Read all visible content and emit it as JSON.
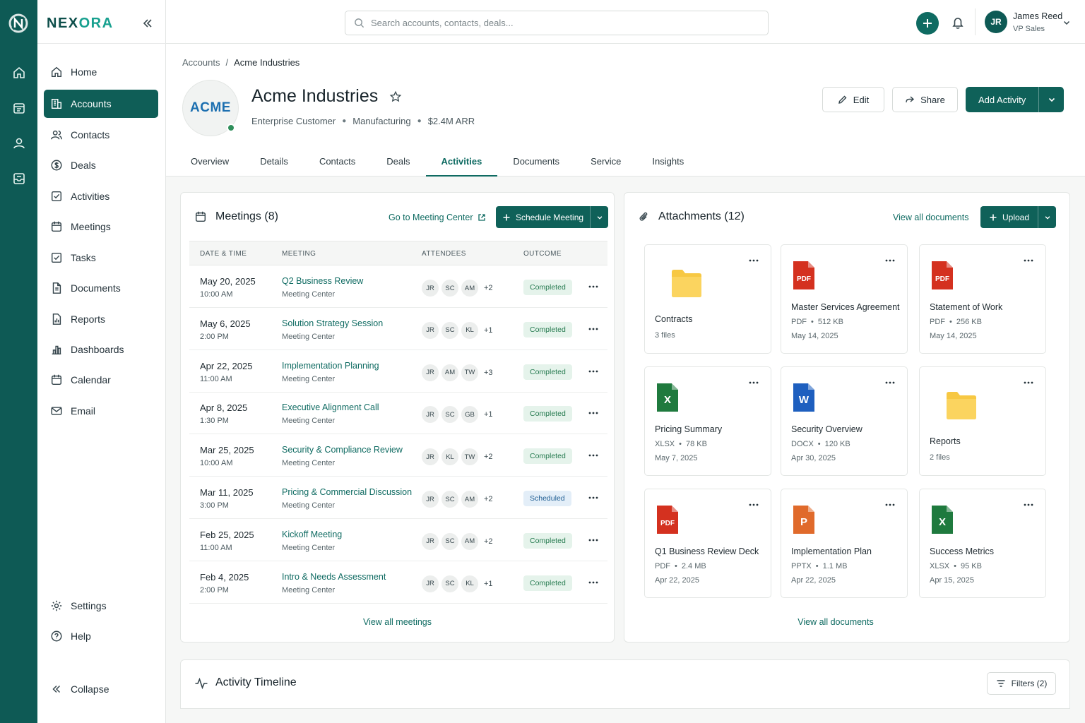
{
  "brand": {
    "name_part1": "NEX",
    "name_part2": "ORA"
  },
  "sidebar": {
    "items": [
      {
        "label": "Home",
        "icon": "home-icon"
      },
      {
        "label": "Accounts",
        "icon": "building-icon",
        "active": true
      },
      {
        "label": "Contacts",
        "icon": "people-icon"
      },
      {
        "label": "Deals",
        "icon": "dollar-icon"
      },
      {
        "label": "Activities",
        "icon": "check-square-icon"
      },
      {
        "label": "Meetings",
        "icon": "calendar-icon"
      },
      {
        "label": "Tasks",
        "icon": "checkbox-icon"
      },
      {
        "label": "Documents",
        "icon": "document-icon"
      },
      {
        "label": "Reports",
        "icon": "report-icon"
      },
      {
        "label": "Dashboards",
        "icon": "bar-chart-icon"
      },
      {
        "label": "Calendar",
        "icon": "calendar-icon"
      },
      {
        "label": "Email",
        "icon": "mail-icon"
      }
    ],
    "settings_label": "Settings",
    "help_label": "Help",
    "collapse_label": "Collapse"
  },
  "topbar": {
    "search_placeholder": "Search accounts, contacts, deals...",
    "user": {
      "initials": "JR",
      "name": "James Reed",
      "role": "VP Sales"
    }
  },
  "breadcrumb": {
    "parent": "Accounts",
    "separator": "/",
    "current": "Acme Industries"
  },
  "account": {
    "logo_text": "ACME",
    "name": "Acme Industries",
    "type": "Enterprise Customer",
    "industry": "Manufacturing",
    "arr": "$2.4M ARR",
    "status_color": "#2f8f5b"
  },
  "actions": {
    "edit": "Edit",
    "share": "Share",
    "add_activity": "Add Activity"
  },
  "tabs": [
    "Overview",
    "Details",
    "Contacts",
    "Deals",
    "Activities",
    "Documents",
    "Service",
    "Insights"
  ],
  "active_tab": "Activities",
  "meetings": {
    "title": "Meetings (8)",
    "go_link": "Go to Meeting Center",
    "schedule_label": "Schedule Meeting",
    "columns": [
      "DATE & TIME",
      "MEETING",
      "ATTENDEES",
      "OUTCOME"
    ],
    "rows": [
      {
        "date": "May 20, 2025",
        "time": "10:00 AM",
        "title": "Q2 Business Review",
        "source": "Meeting Center",
        "attendees": [
          "JR",
          "SC",
          "AM"
        ],
        "more": "+2",
        "outcome": "Completed"
      },
      {
        "date": "May 6, 2025",
        "time": "2:00 PM",
        "title": "Solution Strategy Session",
        "source": "Meeting Center",
        "attendees": [
          "JR",
          "SC",
          "KL"
        ],
        "more": "+1",
        "outcome": "Completed"
      },
      {
        "date": "Apr 22, 2025",
        "time": "11:00 AM",
        "title": "Implementation Planning",
        "source": "Meeting Center",
        "attendees": [
          "JR",
          "AM",
          "TW"
        ],
        "more": "+3",
        "outcome": "Completed"
      },
      {
        "date": "Apr 8, 2025",
        "time": "1:30 PM",
        "title": "Executive Alignment Call",
        "source": "Meeting Center",
        "attendees": [
          "JR",
          "SC",
          "GB"
        ],
        "more": "+1",
        "outcome": "Completed"
      },
      {
        "date": "Mar 25, 2025",
        "time": "10:00 AM",
        "title": "Security & Compliance Review",
        "source": "Meeting Center",
        "attendees": [
          "JR",
          "KL",
          "TW"
        ],
        "more": "+2",
        "outcome": "Completed"
      },
      {
        "date": "Mar 11, 2025",
        "time": "3:00 PM",
        "title": "Pricing & Commercial Discussion",
        "source": "Meeting Center",
        "attendees": [
          "JR",
          "SC",
          "AM"
        ],
        "more": "+2",
        "outcome": "Scheduled"
      },
      {
        "date": "Feb 25, 2025",
        "time": "11:00 AM",
        "title": "Kickoff Meeting",
        "source": "Meeting Center",
        "attendees": [
          "JR",
          "SC",
          "AM"
        ],
        "more": "+2",
        "outcome": "Completed"
      },
      {
        "date": "Feb 4, 2025",
        "time": "2:00 PM",
        "title": "Intro & Needs Assessment",
        "source": "Meeting Center",
        "attendees": [
          "JR",
          "SC",
          "KL"
        ],
        "more": "+1",
        "outcome": "Completed"
      }
    ],
    "view_all": "View all meetings"
  },
  "attachments": {
    "title": "Attachments (12)",
    "view_all_docs_link": "View all documents",
    "upload_label": "Upload",
    "items": [
      {
        "kind": "folder",
        "name": "Contracts",
        "meta": "3 files"
      },
      {
        "kind": "pdf",
        "badge": "PDF",
        "name": "Master Services Agreement",
        "type": "PDF",
        "size": "512 KB",
        "date": "May 14, 2025"
      },
      {
        "kind": "pdf",
        "badge": "PDF",
        "name": "Statement of Work",
        "type": "PDF",
        "size": "256 KB",
        "date": "May 14, 2025"
      },
      {
        "kind": "xlsx",
        "badge": "X",
        "name": "Pricing Summary",
        "type": "XLSX",
        "size": "78 KB",
        "date": "May 7, 2025"
      },
      {
        "kind": "docx",
        "badge": "W",
        "name": "Security Overview",
        "type": "DOCX",
        "size": "120 KB",
        "date": "Apr 30, 2025"
      },
      {
        "kind": "folder",
        "name": "Reports",
        "meta": "2 files"
      },
      {
        "kind": "pdf",
        "badge": "PDF",
        "name": "Q1 Business Review Deck",
        "type": "PDF",
        "size": "2.4 MB",
        "date": "Apr 22, 2025"
      },
      {
        "kind": "pptx",
        "badge": "P",
        "name": "Implementation Plan",
        "type": "PPTX",
        "size": "1.1 MB",
        "date": "Apr 22, 2025"
      },
      {
        "kind": "xlsx",
        "badge": "X",
        "name": "Success Metrics",
        "type": "XLSX",
        "size": "95 KB",
        "date": "Apr 15, 2025"
      }
    ],
    "view_all": "View all documents"
  },
  "timeline": {
    "title": "Activity Timeline",
    "filters_label": "Filters (2)"
  },
  "colors": {
    "primary": "#0f6159",
    "rail": "#0e5a55",
    "completed": "#257a4f",
    "scheduled": "#1f5e93",
    "pdf": "#d4311f",
    "xlsx": "#1f7a3e",
    "docx": "#1e5fbf",
    "pptx": "#e06a2b",
    "folder": "#f7c843"
  }
}
